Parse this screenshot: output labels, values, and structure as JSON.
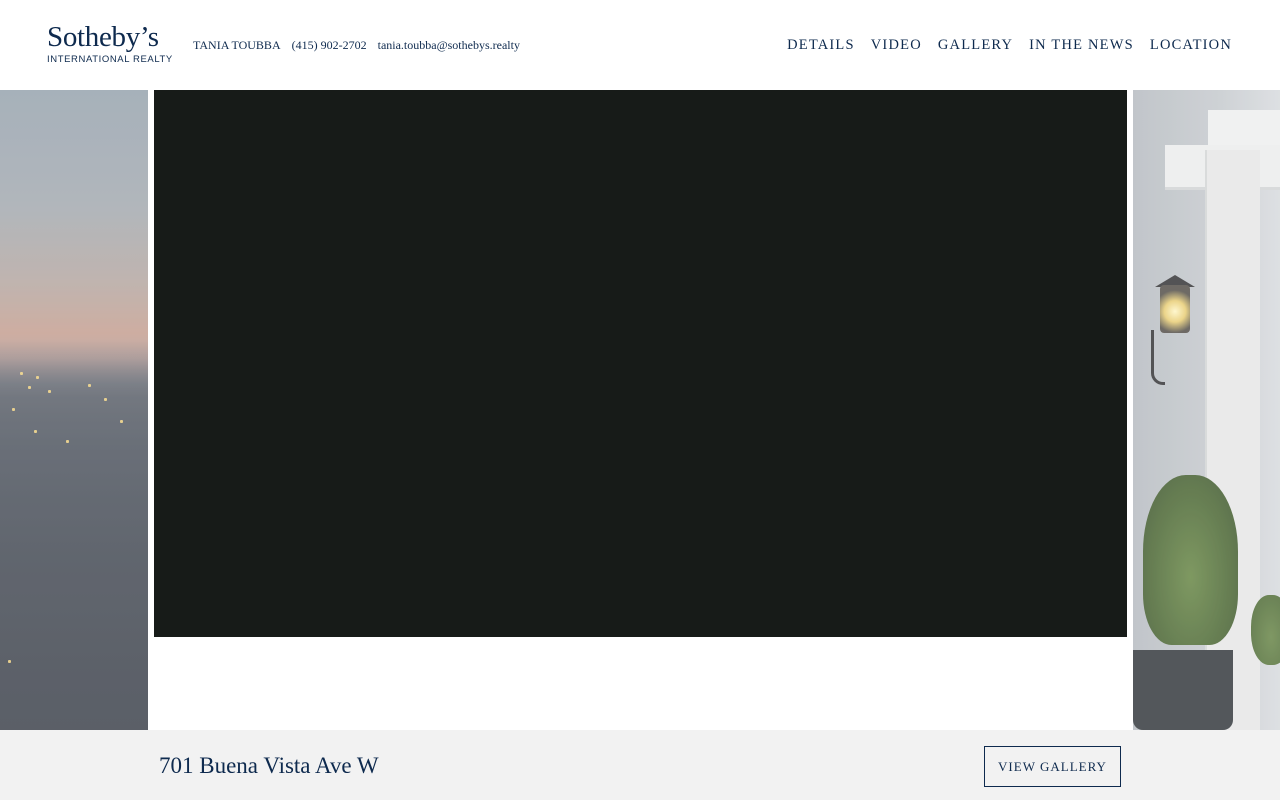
{
  "header": {
    "logo": {
      "wordmark": "Sotheby’s",
      "subline": "INTERNATIONAL REALTY"
    },
    "agent": {
      "name": "TANIA TOUBBA",
      "phone": "(415) 902-2702",
      "email": "tania.toubba@sothebys.realty"
    },
    "nav": [
      {
        "label": "DETAILS"
      },
      {
        "label": "VIDEO"
      },
      {
        "label": "GALLERY"
      },
      {
        "label": "IN THE NEWS"
      },
      {
        "label": "LOCATION"
      }
    ]
  },
  "hero": {
    "video_background": "#171b18"
  },
  "footer_bar": {
    "address": "701 Buena Vista Ave W",
    "view_gallery_label": "VIEW GALLERY"
  },
  "colors": {
    "brand_navy": "#0e2a4e",
    "bar_background": "#f2f2f2"
  }
}
